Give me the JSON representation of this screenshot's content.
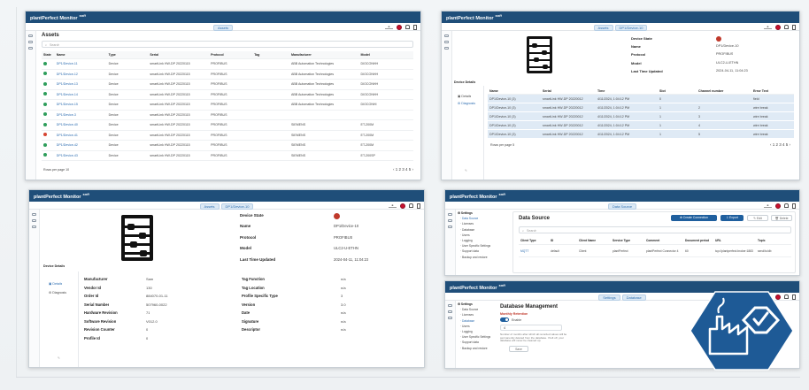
{
  "app": {
    "brand": "plantPerfect Monitor",
    "brand_tag": "soft",
    "user_label": "Open Session"
  },
  "panel_assets": {
    "crumbs": [
      "Assets"
    ],
    "title": "Assets",
    "search_placeholder": "Search",
    "columns": [
      "State",
      "Name",
      "Type",
      "Serial",
      "Protocol",
      "Tag",
      "Manufacturer",
      "Model"
    ],
    "rows": [
      {
        "state": "green",
        "name": "DP1/Device-11",
        "type": "Device",
        "serial": "smartLink HW-DP 20220115",
        "protocol": "PROFIBUS",
        "tag": "",
        "manufacturer": "ABB Automation Technologies",
        "model": "DIOCONHH"
      },
      {
        "state": "green",
        "name": "DP1/Device-12",
        "type": "Device",
        "serial": "smartLink HW-DP 20220115",
        "protocol": "PROFIBUS",
        "tag": "",
        "manufacturer": "ABB Automation Technologies",
        "model": "DIOCONHH"
      },
      {
        "state": "green",
        "name": "DP1/Device-13",
        "type": "Device",
        "serial": "smartLink HW-DP 20220115",
        "protocol": "PROFIBUS",
        "tag": "",
        "manufacturer": "ABB Automation Technologies",
        "model": "DIOCONHH"
      },
      {
        "state": "green",
        "name": "DP1/Device-14",
        "type": "Device",
        "serial": "smartLink HW-DP 20220115",
        "protocol": "PROFIBUS",
        "tag": "",
        "manufacturer": "ABB Automation Technologies",
        "model": "DIOCONHH"
      },
      {
        "state": "green",
        "name": "DP1/Device-15",
        "type": "Device",
        "serial": "smartLink HW-DP 20220115",
        "protocol": "PROFIBUS",
        "tag": "",
        "manufacturer": "ABB Automation Technologies",
        "model": "DIOCONHI"
      },
      {
        "state": "green",
        "name": "DP1/Device-3",
        "type": "Device",
        "serial": "smartLink HW-DP 20220115",
        "protocol": "PROFIBUS",
        "tag": "",
        "manufacturer": "",
        "model": ""
      },
      {
        "state": "green",
        "name": "DP1/Device-40",
        "type": "Device",
        "serial": "smartLink HW-DP 20220115",
        "protocol": "PROFIBUS",
        "tag": "",
        "manufacturer": "SIEMENS",
        "model": "ET-200M"
      },
      {
        "state": "red",
        "name": "DP1/Device-41",
        "type": "Device",
        "serial": "smartLink HW-DP 20220115",
        "protocol": "PROFIBUS",
        "tag": "",
        "manufacturer": "SIEMENS",
        "model": "ET-200M"
      },
      {
        "state": "green",
        "name": "DP1/Device-42",
        "type": "Device",
        "serial": "smartLink HW-DP 20220115",
        "protocol": "PROFIBUS",
        "tag": "",
        "manufacturer": "SIEMENS",
        "model": "ET-200M"
      },
      {
        "state": "green",
        "name": "DP1/Device-43",
        "type": "Device",
        "serial": "smartLink HW-DP 20220115",
        "protocol": "PROFIBUS",
        "tag": "",
        "manufacturer": "SIEMENS",
        "model": "ET-200SP"
      }
    ],
    "rows_per_page": "Rows per page 10",
    "pagination": "‹ 1 2 3 4 5 ›"
  },
  "panel_diag": {
    "crumbs": [
      "Assets",
      "DP1/Device-10"
    ],
    "state_labels": [
      "Device State",
      "Name",
      "Protocol",
      "Model",
      "Last Time Updated"
    ],
    "state_values": [
      "",
      "DP1/Device-10",
      "PROFIBUS",
      "ULC2-U-ETHN",
      "2024-04-11, 11:04:23"
    ],
    "section": "Device Details",
    "nav": [
      "Details",
      "Diagnosis"
    ],
    "columns": [
      "Name",
      "Serial",
      "Time",
      "Slot",
      "Channel number",
      "Error Text"
    ],
    "rows": [
      [
        "DP1/Device-10 (3)",
        "smartLink HW-DP 20220012",
        "4/11/2024, 1:04:12 PM",
        "0",
        "",
        "field"
      ],
      [
        "DP1/Device-10 (3)",
        "smartLink HW-DP 20220012",
        "4/11/2024, 1:04:12 PM",
        "1",
        "2",
        "wire break"
      ],
      [
        "DP1/Device-10 (3)",
        "smartLink HW-DP 20220012",
        "4/11/2024, 1:04:12 PM",
        "1",
        "3",
        "wire break"
      ],
      [
        "DP1/Device-10 (3)",
        "smartLink HW-DP 20220012",
        "4/11/2024, 1:04:12 PM",
        "1",
        "4",
        "wire break"
      ],
      [
        "DP1/Device-10 (3)",
        "smartLink HW-DP 20220012",
        "4/11/2024, 1:04:12 PM",
        "1",
        "5",
        "wire break"
      ]
    ],
    "rows_per_page": "Rows per page 5",
    "pagination": "‹ 1 2 3 4 5 ›"
  },
  "panel_details": {
    "crumbs": [
      "Assets",
      "DP1/Device-10"
    ],
    "state_labels": [
      "Device State",
      "Name",
      "Protocol",
      "Model",
      "Last Time Updated"
    ],
    "state_values": [
      "",
      "DP1/Device-10",
      "PROFIBUS",
      "ULC2-U-ETHN",
      "2024-04-11, 11:04:23"
    ],
    "section": "Device Details",
    "nav": [
      "Details",
      "Diagnosis"
    ],
    "left_labels": [
      "Manufacturer",
      "Vendor Id",
      "Order Id",
      "Serial Number",
      "Hardware Revision",
      "Software Revision",
      "Revision Counter",
      "Profile Id"
    ],
    "left_values": [
      "Sam",
      "130",
      "884070-01-11",
      "507960-0022",
      "71",
      "V012.0",
      "0",
      "0"
    ],
    "right_labels": [
      "Tag Function",
      "Tag Location",
      "Profile Specific Type",
      "Version",
      "Date",
      "Signature",
      "Descriptor"
    ],
    "right_values": [
      "n/a",
      "n/a",
      "3",
      "3.0",
      "n/a",
      "n/a",
      "n/a"
    ]
  },
  "panel_datasource": {
    "crumbs": [
      "Data Source"
    ],
    "nav": [
      "Settings",
      "Data Source",
      "Licenses",
      "Database",
      "Users",
      "Logging",
      "User Specific Settings",
      "Support data",
      "Backup and restore"
    ],
    "title": "Data Source",
    "btn_create": "Create Connection",
    "btn_export": "Export",
    "btn_edit": "Edit",
    "btn_delete": "Delete",
    "search_placeholder": "Search",
    "columns": [
      "Client Type",
      "ID",
      "Client Name",
      "Service Type",
      "Comment",
      "Document period",
      "URL",
      "Topic"
    ],
    "row": [
      "MQTT",
      "default",
      "Client",
      "plantPerfect",
      "plantPerfect Connector 4",
      "60",
      "tcp://plantperfect.broker:1883",
      "send/to/db"
    ]
  },
  "panel_database": {
    "crumbs": [
      "Settings",
      "Database"
    ],
    "nav": [
      "Settings",
      "Data Source",
      "Licenses",
      "Database",
      "Users",
      "Logging",
      "User Specific Settings",
      "Support data",
      "Backup and restore"
    ],
    "title": "Database Management",
    "section": "Monthly Retention",
    "toggle_label": "Enable",
    "months": "4",
    "note": "Number of months after which all recorded values will be permanently deleted from the database. If left off, your database will never be cleaned up.",
    "save": "Save"
  },
  "colors": {
    "brand": "#1f4e79",
    "green": "#2e9e5b",
    "red": "#d64532",
    "accent": "#1f5f9e",
    "hex": "#1e5a96"
  },
  "icons": [
    "menu-icon",
    "search-icon",
    "user-icon",
    "flag-icon",
    "bell-icon",
    "logout-icon",
    "abacus-icon",
    "factory-check-icon"
  ]
}
